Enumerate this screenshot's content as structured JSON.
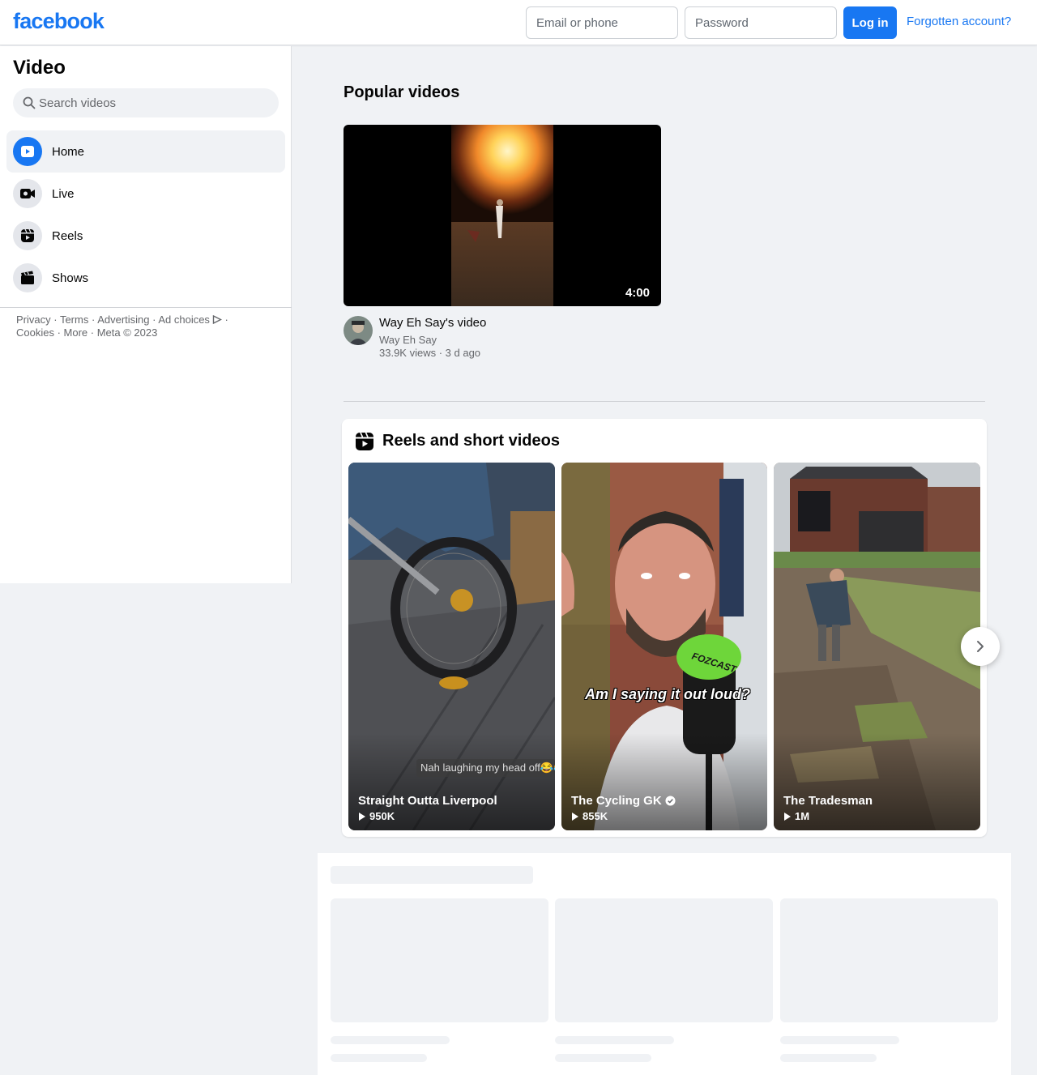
{
  "header": {
    "logo": "facebook",
    "email_placeholder": "Email or phone",
    "password_placeholder": "Password",
    "login_label": "Log in",
    "forgot_label": "Forgotten account?",
    "accent_color": "#1877f2"
  },
  "sidebar": {
    "title": "Video",
    "search_placeholder": "Search videos",
    "items": [
      {
        "label": "Home",
        "icon": "video-play-icon",
        "active": true
      },
      {
        "label": "Live",
        "icon": "live-camera-icon",
        "active": false
      },
      {
        "label": "Reels",
        "icon": "reels-icon",
        "active": false
      },
      {
        "label": "Shows",
        "icon": "clapperboard-icon",
        "active": false
      }
    ],
    "footer": {
      "privacy": "Privacy",
      "terms": "Terms",
      "advertising": "Advertising",
      "ad_choices": "Ad choices",
      "cookies": "Cookies",
      "more": "More",
      "copyright": "Meta © 2023"
    }
  },
  "popular": {
    "title": "Popular videos",
    "video": {
      "duration": "4:00",
      "title": "Way Eh Say's video",
      "author": "Way Eh Say",
      "views": "33.9K views",
      "age": "3 d ago"
    }
  },
  "reels": {
    "title": "Reels and short videos",
    "items": [
      {
        "name": "Straight Outta Liverpool",
        "views": "950K",
        "caption": "Nah laughing my head off😂😂",
        "verified": false
      },
      {
        "name": "The Cycling GK",
        "views": "855K",
        "caption": "Am I saying it out loud?",
        "mic_brand": "FOZCAST",
        "verified": true
      },
      {
        "name": "The Tradesman",
        "views": "1M",
        "verified": false
      }
    ]
  }
}
